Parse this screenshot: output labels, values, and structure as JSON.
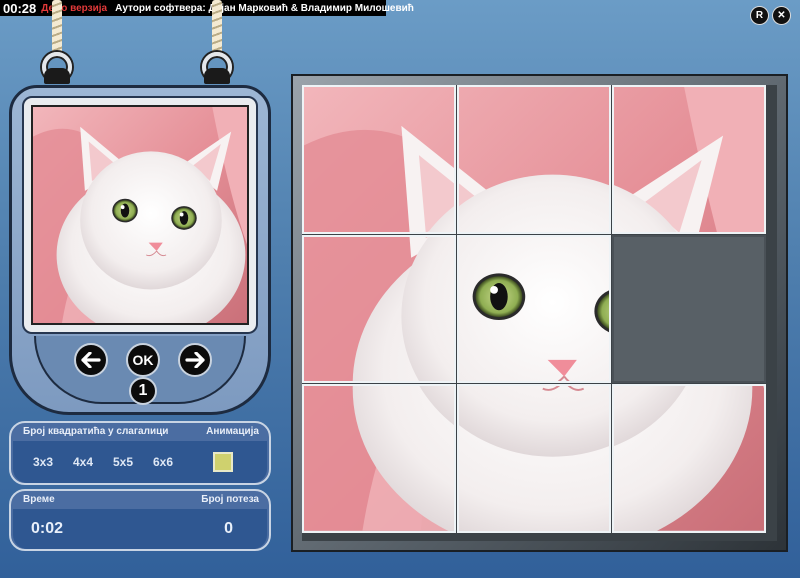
{
  "topbar": {
    "timer": "00:28",
    "demo_label": "Демо верзија",
    "authors": "Аутори софтвера: Дејан Марковић & Владимир Милошевић"
  },
  "window_buttons": {
    "restart": "R",
    "close": "✕"
  },
  "preview_panel": {
    "prev_symbol": "🡐",
    "ok_label": "OK",
    "next_symbol": "🡒",
    "level": "1"
  },
  "size_panel": {
    "heading": "Број квадратића у слагалици",
    "animation_heading": "Анимација",
    "options": [
      "3x3",
      "4x4",
      "5x5",
      "6x6"
    ]
  },
  "stats_panel": {
    "time_heading": "Време",
    "moves_heading": "Број потеза",
    "time_value": "0:02",
    "moves_value": "0"
  },
  "board": {
    "grid_size": 3,
    "empty_cell": [
      1,
      2
    ]
  },
  "colors": {
    "background_top": "#6b9cc6",
    "panel_fill": "#2f5791",
    "empty_tile": "#586066",
    "fabric_pink": "#e79aa0"
  }
}
